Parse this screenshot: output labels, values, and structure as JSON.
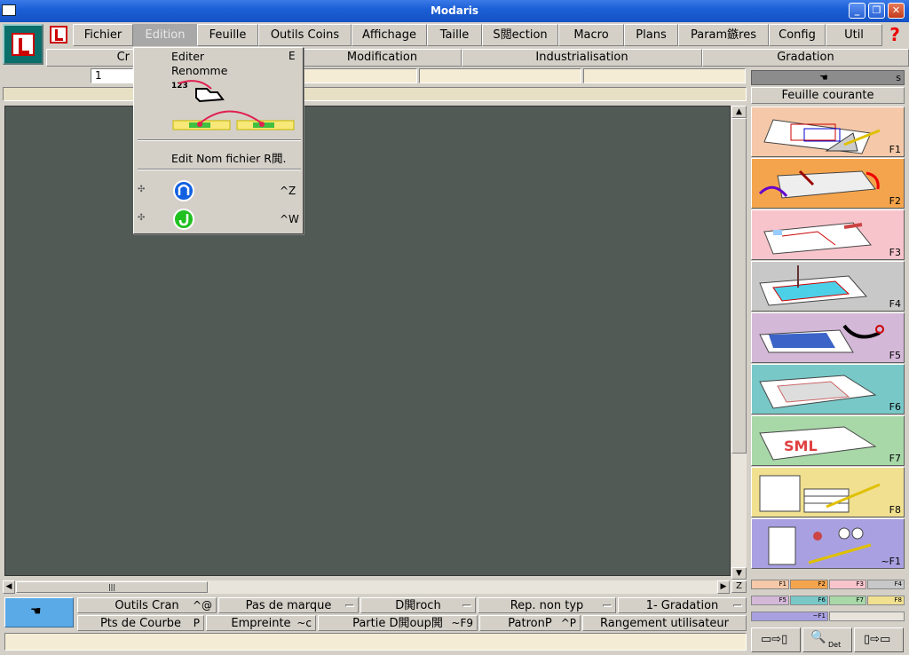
{
  "window": {
    "title": "Modaris"
  },
  "menu": {
    "items": [
      "Fichier",
      "Edition",
      "Feuille",
      "Outils Coins",
      "Affichage",
      "Taille",
      "S閲ection",
      "Macro",
      "Plans",
      "Param鏃res",
      "Config",
      "Util"
    ],
    "help": "?"
  },
  "submenu": {
    "items": [
      "Cr",
      "Modification",
      "Industrialisation",
      "Gradation"
    ]
  },
  "fields": {
    "first": "1"
  },
  "dropdown": {
    "edit": "Editer",
    "edit_key": "E",
    "rename": "Renomme",
    "rename_num": "123",
    "edit_filename": "Edit Nom fichier R閧.",
    "undo_key": "^Z",
    "redo_key": "^W"
  },
  "right_panel": {
    "top_label": "s",
    "sheet": "Feuille courante",
    "fkeys": [
      "F1",
      "F2",
      "F3",
      "F4",
      "F5",
      "F6",
      "F7",
      "F8",
      "~F1"
    ],
    "colors": [
      "#f4c8a8",
      "#f4a44c",
      "#f8c4cc",
      "#c8c8c8",
      "#d4b8d8",
      "#78c8c8",
      "#a8d8a8",
      "#f0e090",
      "#a8a0e0"
    ],
    "legend": [
      "F1",
      "F2",
      "F3",
      "F4",
      "F5",
      "F6",
      "F7",
      "F8",
      "~F1"
    ]
  },
  "bottom_tools": {
    "row1": [
      {
        "label": "Outils Cran",
        "key": "^@"
      },
      {
        "label": "Pas de marque",
        "key": ""
      },
      {
        "label": "D閧roch",
        "key": ""
      },
      {
        "label": "Rep. non typ",
        "key": ""
      },
      {
        "label": "1- Gradation",
        "key": ""
      }
    ],
    "row2": [
      {
        "label": "Pts de Courbe",
        "key": "P"
      },
      {
        "label": "Empreinte",
        "key": "~c"
      },
      {
        "label": "Partie D閧oup閧",
        "key": "~F9"
      },
      {
        "label": "PatronP",
        "key": "^P"
      },
      {
        "label": "Rangement utilisateur",
        "key": ""
      }
    ],
    "tool_labels": [
      "Det"
    ]
  }
}
